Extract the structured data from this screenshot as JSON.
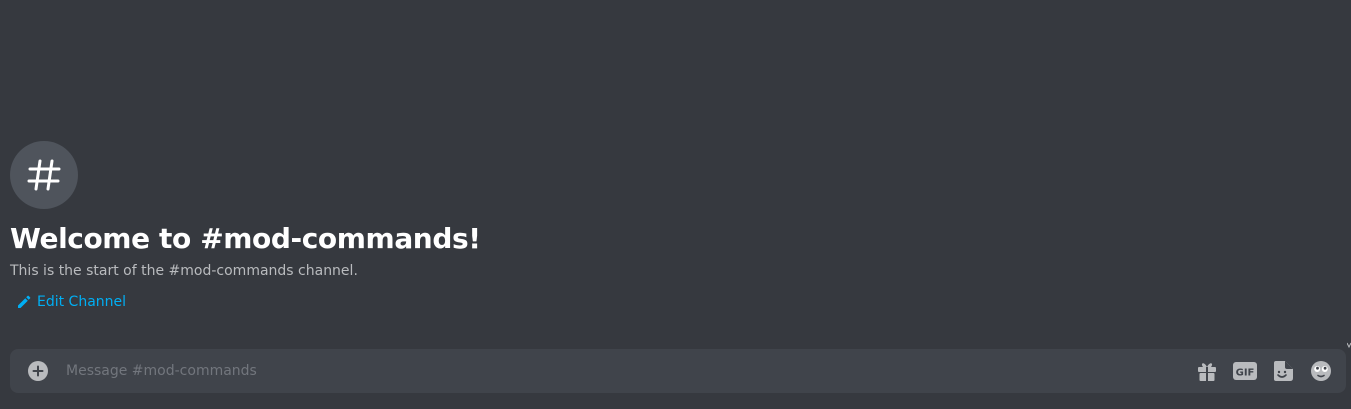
{
  "channel": {
    "name": "mod-commands",
    "icon": "hash-icon"
  },
  "welcome": {
    "title": "Welcome to #mod-commands!",
    "description": "This is the start of the #mod-commands channel.",
    "edit_label": "Edit Channel"
  },
  "composer": {
    "placeholder": "Message #mod-commands",
    "value": "",
    "buttons": {
      "attach_icon": "plus-circle-icon",
      "gift_icon": "gift-icon",
      "gif_label": "GIF",
      "sticker_icon": "sticker-icon",
      "emoji_icon": "emoji-icon"
    }
  },
  "colors": {
    "background": "#36393f",
    "composer": "#40444b",
    "link": "#00aff4",
    "heading": "#ffffff",
    "muted": "#b9bbbe",
    "icon": "#b9bbbe"
  }
}
